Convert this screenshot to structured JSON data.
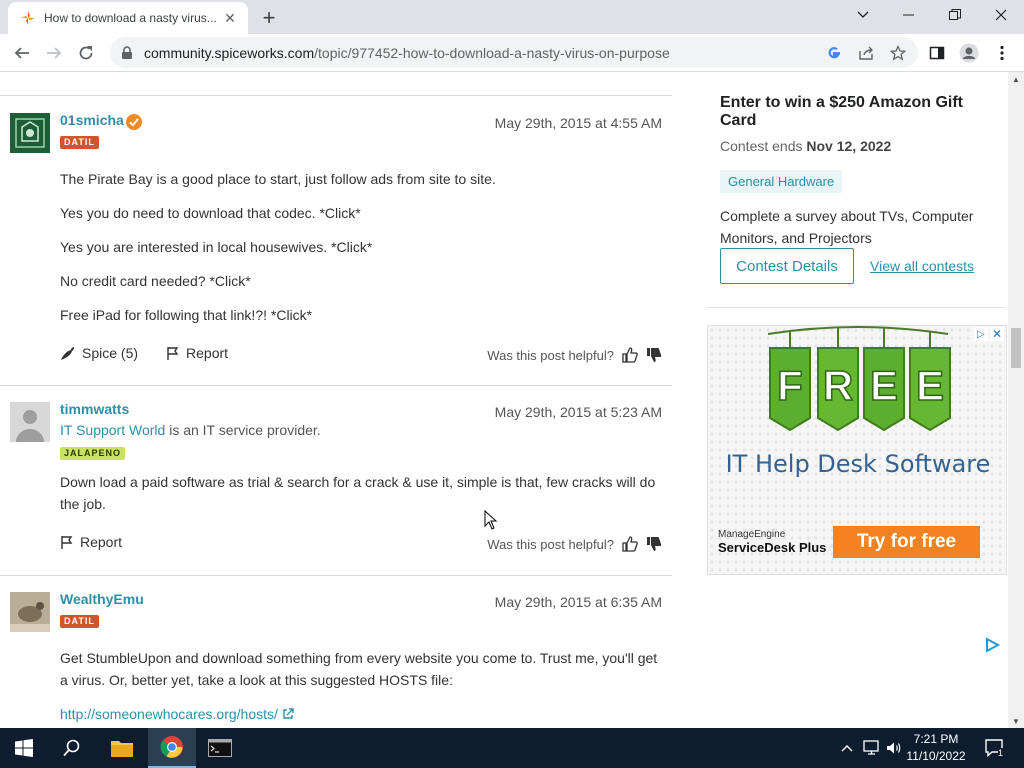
{
  "browser": {
    "tab_title": "How to download a nasty virus...",
    "tab_close": "✕",
    "new_tab": "+",
    "url_domain": "community.spiceworks.com",
    "url_path": "/topic/977452-how-to-download-a-nasty-virus-on-purpose"
  },
  "posts": [
    {
      "username": "01smicha",
      "badge": "DATIL",
      "date": "May 29th, 2015 at 4:55 AM",
      "lines": [
        "The Pirate Bay is a good place to start, just follow ads from site to site.",
        "Yes you do need to download that codec. *Click*",
        "Yes you are interested in local housewives. *Click*",
        "No credit card needed? *Click*",
        "Free iPad for following that link!?! *Click*"
      ],
      "spice_label": "Spice (5)",
      "report_label": "Report",
      "helpful_label": "Was this post helpful?"
    },
    {
      "username": "timmwatts",
      "affiliation_link": "IT Support World",
      "affiliation_rest": " is an IT service provider.",
      "badge": "JALAPENO",
      "date": "May 29th, 2015 at 5:23 AM",
      "lines": [
        "Down load a paid software as trial & search for a crack & use it, simple is that, few cracks will do",
        "the job."
      ],
      "report_label": "Report",
      "helpful_label": "Was this post helpful?"
    },
    {
      "username": "WealthyEmu",
      "badge": "DATIL",
      "date": "May 29th, 2015 at 6:35 AM",
      "lines": [
        "Get StumbleUpon and download something from every website you come to. Trust me, you'll get",
        "a virus. Or, better yet, take a look at this suggested HOSTS file:"
      ],
      "link": "http://someonewhocares.org/hosts/"
    }
  ],
  "sidebar": {
    "contest_title": "Enter to win a $250 Amazon Gift Card",
    "contest_ends_label": "Contest ends ",
    "contest_ends_date": "Nov 12, 2022",
    "tag": "General Hardware",
    "description": "Complete a survey about TVs, Computer Monitors, and Projectors",
    "details_button": "Contest Details",
    "view_all": "View all contests"
  },
  "ad": {
    "tag_letters": [
      "F",
      "R",
      "E",
      "E"
    ],
    "headline": "IT Help Desk Software",
    "brand_top": "ManageEngine",
    "brand_product": "ServiceDesk Plus",
    "cta": "Try for free",
    "close": "✕"
  },
  "taskbar": {
    "time": "7:21 PM",
    "date": "11/10/2022",
    "notification_count": "1"
  },
  "colors": {
    "link": "#2e8fa6",
    "badge_datil": "#d0562a",
    "badge_jalapeno": "#c9e265",
    "ad_cta": "#f58220"
  }
}
